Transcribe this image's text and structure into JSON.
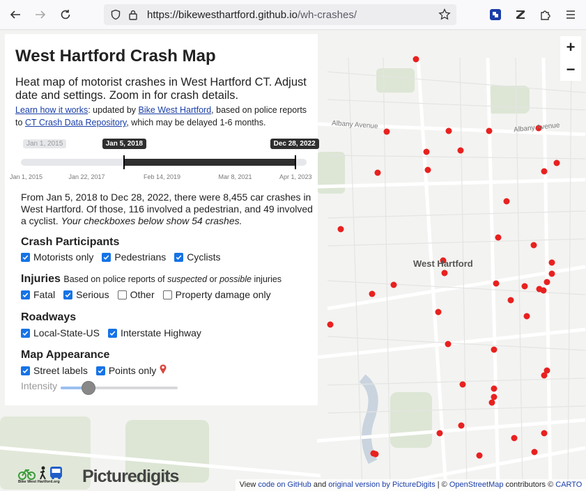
{
  "browser": {
    "url_host": "https://bikewesthartford.github.io",
    "url_path": "/wh-crashes/",
    "icons": [
      "back-arrow-icon",
      "forward-arrow-icon",
      "reload-icon",
      "shield-icon",
      "lock-icon",
      "star-icon",
      "extension-icon",
      "zotero-icon",
      "puzzle-icon",
      "menu-icon"
    ]
  },
  "panel": {
    "title": "West Hartford Crash Map",
    "lead": "Heat map of motorist crashes in West Hartford CT. Adjust date and settings. Zoom in for crash details.",
    "link_how": "Learn how it works",
    "note_mid": ": updated by ",
    "link_bwh": "Bike West Hartford",
    "note_mid2": ", based on police reports to ",
    "link_ct": "CT Crash Data Repository",
    "note_end": ", which may be delayed 1-6 months."
  },
  "date_slider": {
    "min_label": "Jan 1, 2015",
    "start_label": "Jan 5, 2018",
    "end_label": "Dec 28, 2022",
    "ticks": [
      "Jan 1, 2015",
      "Jan 22, 2017",
      "Feb 14, 2019",
      "Mar 8, 2021",
      "Apr 1, 2023"
    ],
    "start_fraction": 0.36,
    "end_fraction": 0.96
  },
  "summary": {
    "text": "From Jan 5, 2018 to Dec 28, 2022, there were 8,455 car crashes in West Hartford. Of those, 116 involved a pedestrian, and 49 involved a cyclist. ",
    "italic": "Your checkboxes below show 54 crashes."
  },
  "participants": {
    "heading": "Crash Participants",
    "options": [
      {
        "label": "Motorists only",
        "checked": true
      },
      {
        "label": "Pedestrians",
        "checked": true
      },
      {
        "label": "Cyclists",
        "checked": true
      }
    ]
  },
  "injuries": {
    "heading": "Injuries",
    "sub_a": "Based on police reports of ",
    "sub_b": "suspected",
    "sub_c": " or ",
    "sub_d": "possible",
    "sub_e": " injuries",
    "options": [
      {
        "label": "Fatal",
        "checked": true
      },
      {
        "label": "Serious",
        "checked": true
      },
      {
        "label": "Other",
        "checked": false
      },
      {
        "label": "Property damage only",
        "checked": false
      }
    ]
  },
  "roadways": {
    "heading": "Roadways",
    "options": [
      {
        "label": "Local-State-US",
        "checked": true
      },
      {
        "label": "Interstate Highway",
        "checked": true
      }
    ]
  },
  "appearance": {
    "heading": "Map Appearance",
    "options": [
      {
        "label": "Street labels",
        "checked": true
      },
      {
        "label": "Points only",
        "checked": true
      }
    ],
    "pin_icon": "map-pin-icon",
    "intensity_label": "Intensity",
    "intensity_level": 0.18
  },
  "map": {
    "labels": {
      "town": "West Hartford",
      "road1": "Albany Avenue",
      "road2": "Albany Avenue"
    },
    "zoom_in": "+",
    "zoom_out": "−",
    "crash_color": "#e8211f",
    "attrib_a": "View ",
    "attrib_b": "code on GitHub",
    "attrib_c": " and ",
    "attrib_d": "original version by PictureDigits",
    "attrib_e": " | © ",
    "attrib_f": "OpenStreetMap",
    "attrib_g": " contributors © ",
    "attrib_h": "CARTO"
  },
  "brands": {
    "picturedigits": "Picturedigits",
    "bwh_text": "Bike West Hartford.org"
  }
}
